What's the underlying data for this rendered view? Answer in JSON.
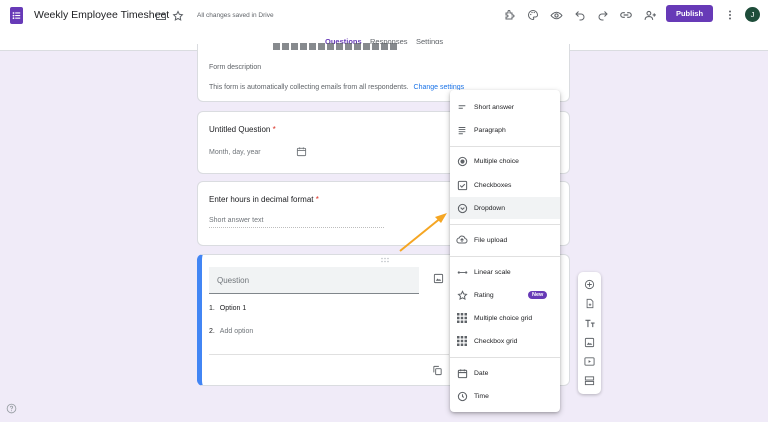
{
  "app": {
    "title": "Weekly Employee Timesheet",
    "save_status": "All changes saved in Drive",
    "publish_label": "Publish",
    "avatar_letter": "J",
    "brand_color": "#673ab7",
    "icons": [
      "forms-logo-icon",
      "folder-icon",
      "star-icon",
      "addon-icon",
      "palette-icon",
      "preview-eye-icon",
      "undo-icon",
      "redo-icon",
      "link-icon",
      "add-collaborator-icon",
      "more-vert-icon"
    ]
  },
  "tabs": [
    {
      "label": "Questions",
      "active": true
    },
    {
      "label": "Responses",
      "active": false
    },
    {
      "label": "Settings",
      "active": false
    }
  ],
  "header_card": {
    "title_partial": "",
    "description_placeholder": "Form description",
    "email_notice": "This form is automatically collecting emails from all respondents.",
    "change_settings_link": "Change settings"
  },
  "questions": [
    {
      "title": "Untitled Question",
      "required_mark": "*",
      "placeholder": "Month, day, year",
      "icon": "calendar-icon"
    },
    {
      "title": "Enter hours in decimal format",
      "required_mark": "*",
      "placeholder": "Short answer text"
    }
  ],
  "active_question": {
    "title_placeholder": "Question",
    "option_1_number": "1.",
    "option_1_label": "Option 1",
    "option_2_number": "2.",
    "add_option_label": "Add option",
    "icons": [
      "drag-handle-icon",
      "image-icon",
      "duplicate-icon"
    ]
  },
  "type_menu": {
    "items": [
      {
        "label": "Short answer",
        "icon": "short-text-icon"
      },
      {
        "label": "Paragraph",
        "icon": "paragraph-icon"
      },
      {
        "label": "Multiple choice",
        "icon": "radio-icon"
      },
      {
        "label": "Checkboxes",
        "icon": "checkbox-icon"
      },
      {
        "label": "Dropdown",
        "icon": "dropdown-icon",
        "highlighted": true
      },
      {
        "label": "File upload",
        "icon": "cloud-upload-icon"
      },
      {
        "label": "Linear scale",
        "icon": "linear-scale-icon"
      },
      {
        "label": "Rating",
        "icon": "star-icon",
        "badge": "New"
      },
      {
        "label": "Multiple choice grid",
        "icon": "grid-icon"
      },
      {
        "label": "Checkbox grid",
        "icon": "checkbox-grid-icon"
      },
      {
        "label": "Date",
        "icon": "calendar-icon"
      },
      {
        "label": "Time",
        "icon": "clock-icon"
      }
    ]
  },
  "side_toolbar": {
    "icons": [
      "add-question-icon",
      "import-questions-icon",
      "add-title-icon",
      "add-image-icon",
      "add-video-icon",
      "add-section-icon"
    ]
  },
  "annotation": {
    "arrow_color": "#f5a623"
  },
  "help": {
    "icon": "help-icon"
  }
}
